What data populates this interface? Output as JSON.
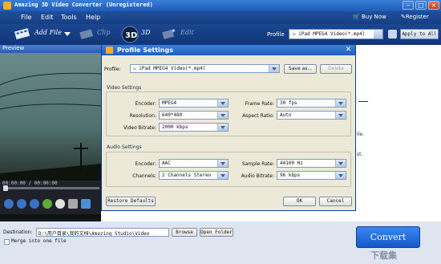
{
  "window": {
    "title": "Amazing 3D Video Converter (Unregistered)"
  },
  "menu": {
    "items": [
      "File",
      "Edit",
      "Tools",
      "Help"
    ]
  },
  "toplinks": {
    "buy_now": "Buy Now",
    "register": "Register"
  },
  "toolbar": {
    "add_file": "Add File",
    "clip": "Clip",
    "three_d": "3D",
    "edit": "Edit",
    "profile_label": "Profile",
    "profile_value": "iPad MPEG4 Video(*.mp4)",
    "apply_all": "Apply to All"
  },
  "preview": {
    "header": "Preview",
    "time": "00:00:00 / 00:00:00"
  },
  "list_side_text": {
    "line1": "ile.",
    "line2": "st."
  },
  "dialog": {
    "title": "Profile Settings",
    "profile_label": "Profile:",
    "profile_value": "iPad MPEG4 Video(*.mp4)",
    "save_as": "Save as...",
    "delete": "Delete",
    "video_section": "Video Settings",
    "encoder_label": "Encoder:",
    "encoder_value": "MPEG4",
    "resolution_label": "Resolution:",
    "resolution_value": "640*480",
    "video_bitrate_label": "Video Bitrate:",
    "video_bitrate_value": "2000 kbps",
    "frame_rate_label": "Frame Rate:",
    "frame_rate_value": "30 fps",
    "aspect_label": "Aspect Ratio:",
    "aspect_value": "Auto",
    "audio_section": "Audio Settings",
    "a_encoder_label": "Encoder:",
    "a_encoder_value": "AAC",
    "channels_label": "Channels:",
    "channels_value": "2 Channels Stereo",
    "sample_rate_label": "Sample Rate:",
    "sample_rate_value": "44100 Hz",
    "audio_bitrate_label": "Audio Bitrate:",
    "audio_bitrate_value": "96 kbps",
    "restore": "Restore Defaults",
    "ok": "OK",
    "cancel": "Cancel"
  },
  "bottom": {
    "destination_label": "Destination:",
    "destination_value": "D:\\用户目录\\我的文档\\Amazing Studio\\Video",
    "browse": "Browse",
    "open_folder": "Open Folder",
    "merge": "Merge into one file",
    "convert": "Convert"
  },
  "watermark": {
    "text": "下载集"
  }
}
